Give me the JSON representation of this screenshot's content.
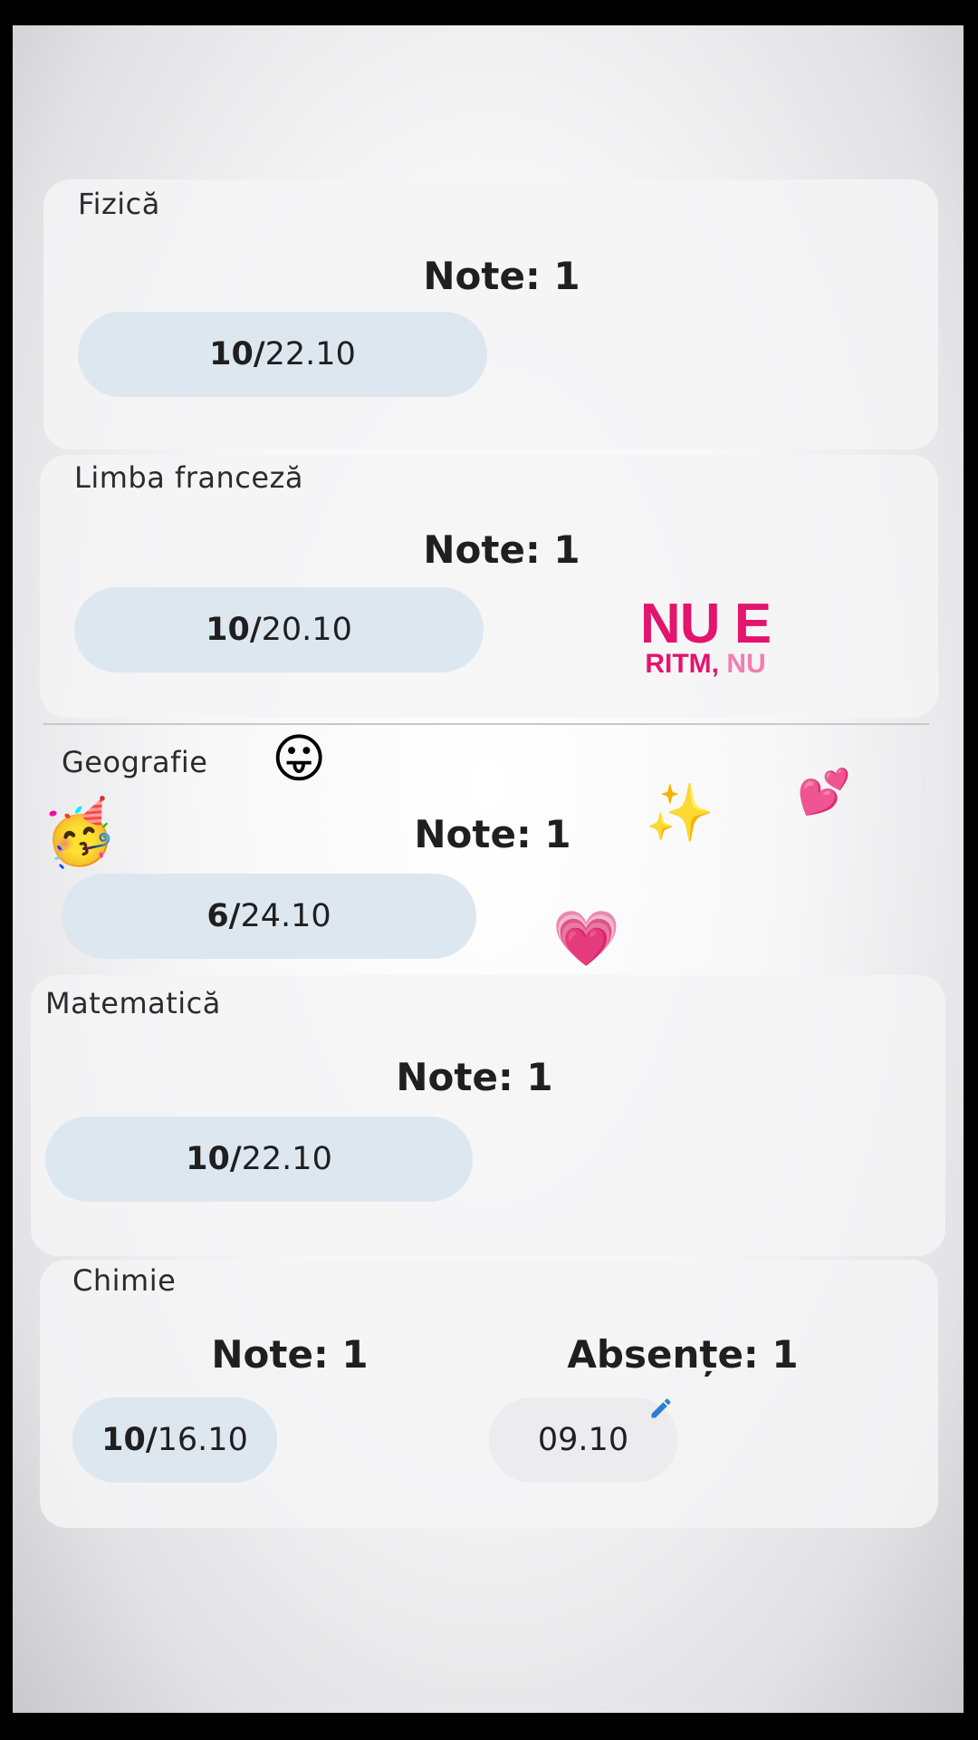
{
  "subjects": [
    {
      "name": "Fizică",
      "grades_title": "Note: 1",
      "grades": [
        {
          "grade": "10/",
          "date": "22.10"
        }
      ]
    },
    {
      "name": "Limba franceză",
      "grades_title": "Note: 1",
      "grades": [
        {
          "grade": "10/",
          "date": "20.10"
        }
      ]
    },
    {
      "name": "Geografie",
      "grades_title": "Note: 1",
      "grades": [
        {
          "grade": "6/",
          "date": "24.10"
        }
      ]
    },
    {
      "name": "Matematică",
      "grades_title": "Note: 1",
      "grades": [
        {
          "grade": "10/",
          "date": "22.10"
        }
      ]
    },
    {
      "name": "Chimie",
      "grades_title": "Note: 1",
      "grades": [
        {
          "grade": "10/",
          "date": "16.10"
        }
      ],
      "absences_title": "Absențe: 1",
      "absences": [
        "09.10"
      ]
    }
  ],
  "sticker": {
    "line1": "NU E",
    "line2a": "RITM,",
    "line2b": "NU"
  },
  "emojis": {
    "tongue": "😛",
    "party": "🥳",
    "sparkles": "✨",
    "two_hearts": "💕",
    "heart": "💗"
  },
  "colors": {
    "pill": "#dde7f0",
    "absence_pill": "#ececee",
    "sticker_pink": "#e3146e",
    "pencil_blue": "#2a7fd1"
  },
  "icons": {
    "edit": "pencil-icon"
  }
}
